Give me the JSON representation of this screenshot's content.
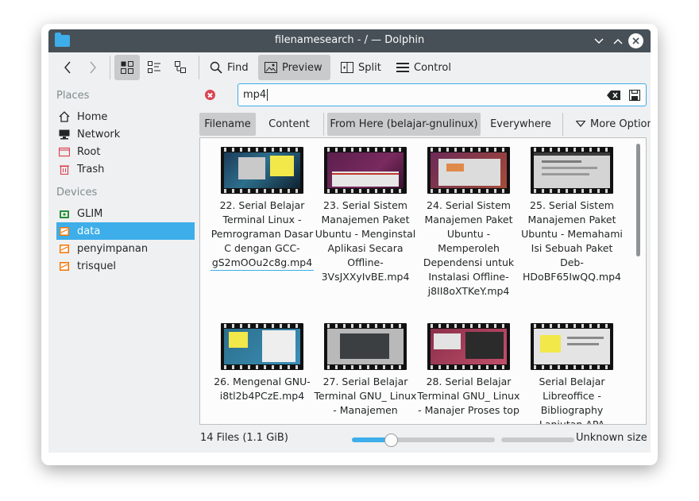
{
  "window": {
    "title": "filenamesearch - / — Dolphin"
  },
  "toolbar": {
    "back_icon": "back-arrow-icon",
    "forward_icon": "forward-arrow-icon",
    "view_modes": [
      "icons-view-icon",
      "compact-view-icon",
      "details-view-icon"
    ],
    "find_label": "Find",
    "preview_label": "Preview",
    "split_label": "Split",
    "control_label": "Control"
  },
  "sidebar": {
    "places_heading": "Places",
    "places": [
      {
        "label": "Home",
        "icon": "home-icon"
      },
      {
        "label": "Network",
        "icon": "network-icon"
      },
      {
        "label": "Root",
        "icon": "root-folder-icon"
      },
      {
        "label": "Trash",
        "icon": "trash-icon"
      }
    ],
    "devices_heading": "Devices",
    "devices": [
      {
        "label": "GLIM",
        "icon": "usb-drive-icon"
      },
      {
        "label": "data",
        "icon": "drive-icon",
        "selected": true
      },
      {
        "label": "penyimpanan",
        "icon": "drive-icon"
      },
      {
        "label": "trisquel",
        "icon": "drive-icon"
      }
    ]
  },
  "search": {
    "value": "mp4"
  },
  "filters": {
    "filename": "Filename",
    "content": "Content",
    "from_here": "From Here (belajar-gnulinux)",
    "everywhere": "Everywhere",
    "more_options": "More Options"
  },
  "files": [
    {
      "name": "22. Serial Belajar Terminal Linux - Pemrograman Dasar C dengan GCC-gS2mOOu2c8g.mp4"
    },
    {
      "name": "23.  Serial Sistem Manajemen Paket Ubuntu - Menginstal Aplikasi Secara Offline-3VsJXXyIvBE.mp4"
    },
    {
      "name": "24. Serial Sistem Manajemen Paket Ubuntu - Memperoleh Dependensi untuk Instalasi Offline-j8II8oXTKeY.mp4"
    },
    {
      "name": "25. Serial Sistem Manajemen Paket Ubuntu - Memahami Isi Sebuah Paket Deb-HDoBF65IwQQ.mp4"
    },
    {
      "name": "26. Mengenal GNU-i8tl2b4PCzE.mp4"
    },
    {
      "name": "27. Serial Belajar Terminal GNU_ Linux  - Manajemen"
    },
    {
      "name": "28. Serial Belajar Terminal GNU_ Linux - Manajer Proses top"
    },
    {
      "name": "Serial Belajar Libreoffice - Bibliography Lanjutan APA"
    }
  ],
  "status": {
    "count": "14 Files (1.1 GiB)",
    "zoom_level": 0.27,
    "free_space": "Unknown size"
  }
}
